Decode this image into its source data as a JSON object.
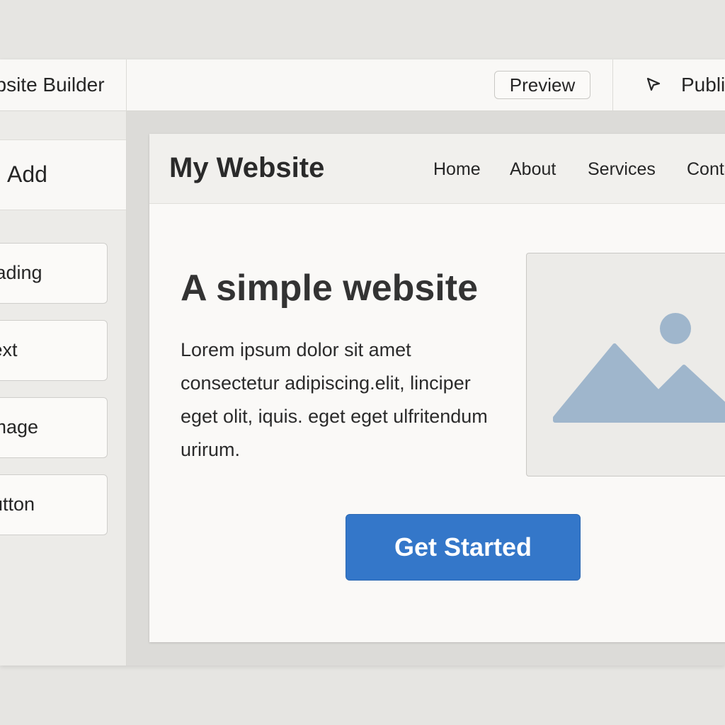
{
  "app": {
    "title": "Website Builder",
    "preview_label": "Preview",
    "publish_label": "Publish"
  },
  "sidebar": {
    "header": "Add",
    "items": [
      {
        "label": "Heading",
        "icon": "heading-block"
      },
      {
        "label": "Text",
        "icon": "text-block"
      },
      {
        "label": "Image",
        "icon": "image-block"
      },
      {
        "label": "Button",
        "icon": "button-block"
      }
    ]
  },
  "site": {
    "title": "My Website",
    "nav": [
      "Home",
      "About",
      "Services",
      "Contact"
    ],
    "hero": {
      "title": "A simple website",
      "body": "Lorem ipsum dolor sit amet consectetur adipiscing.elit, linciper eget olit, iquis. eget eget ulfritendum urirum.",
      "image_icon": "image-placeholder-icon",
      "cta_label": "Get Started"
    }
  },
  "colors": {
    "accent": "#3477c9",
    "placeholder_graphic": "#9fb6cc",
    "background": "#e6e5e2"
  }
}
